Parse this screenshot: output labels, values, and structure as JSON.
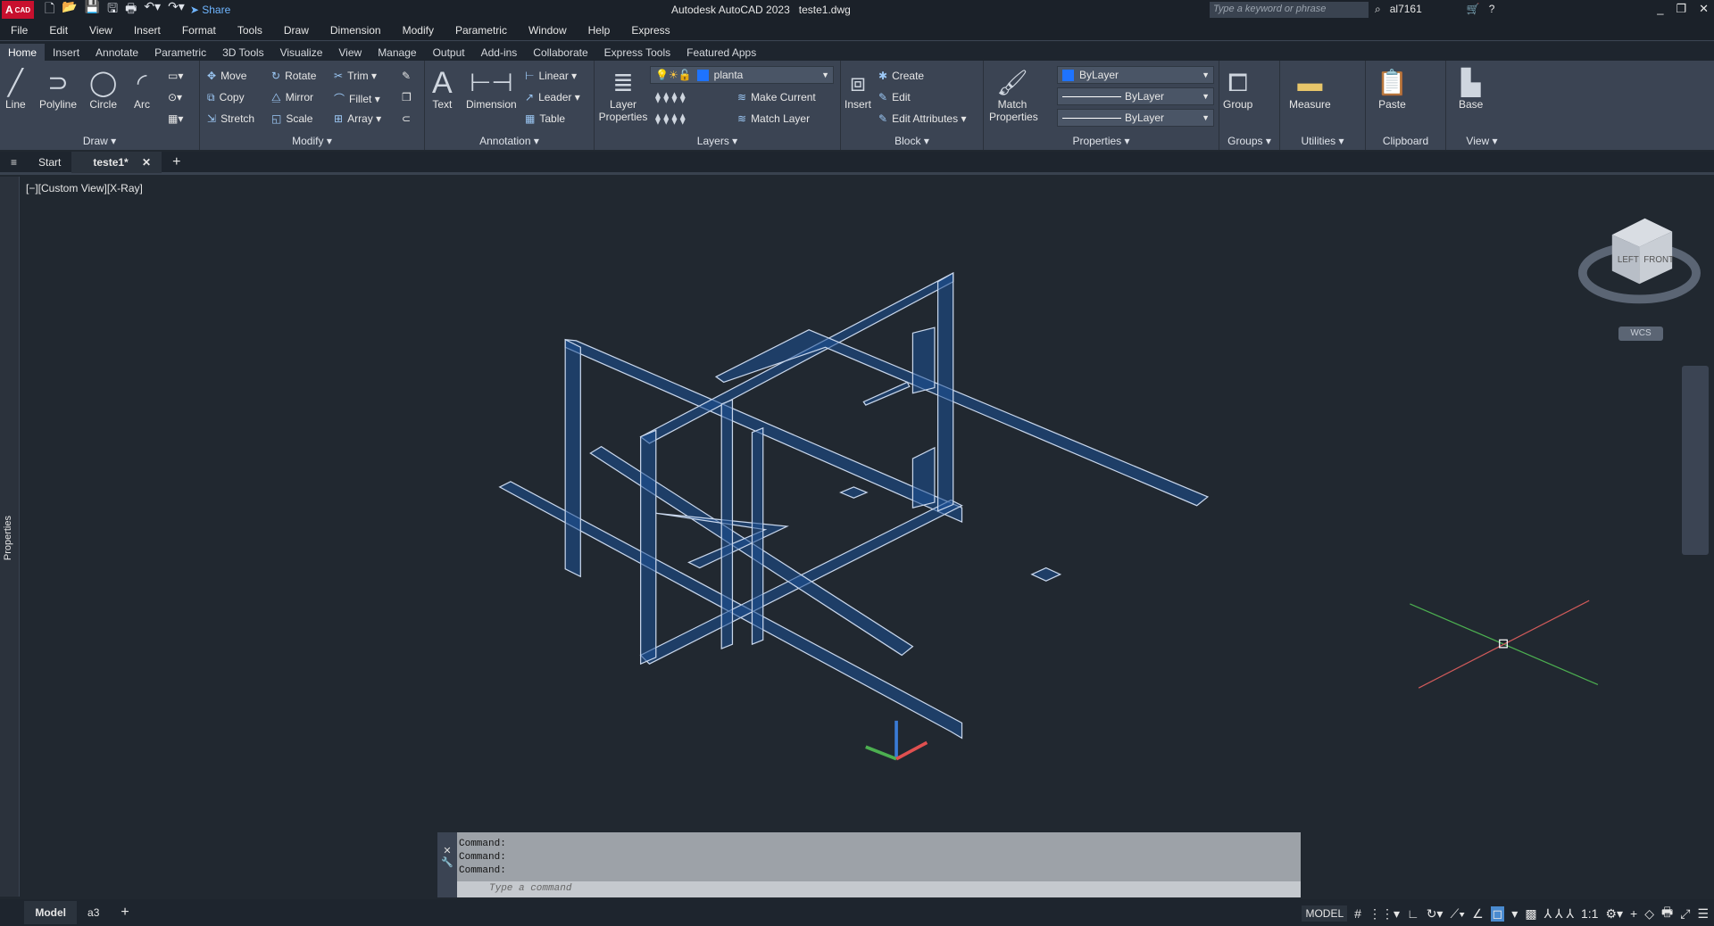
{
  "app": {
    "logo": "A",
    "logo_sub": "CAD",
    "title": "Autodesk AutoCAD 2023",
    "file": "teste1.dwg",
    "share": "Share",
    "search_placeholder": "Type a keyword or phrase",
    "user": "al7161"
  },
  "menu": [
    "File",
    "Edit",
    "View",
    "Insert",
    "Format",
    "Tools",
    "Draw",
    "Dimension",
    "Modify",
    "Parametric",
    "Window",
    "Help",
    "Express"
  ],
  "ribbon_tabs": [
    "Home",
    "Insert",
    "Annotate",
    "Parametric",
    "3D Tools",
    "Visualize",
    "View",
    "Manage",
    "Output",
    "Add-ins",
    "Collaborate",
    "Express Tools",
    "Featured Apps"
  ],
  "draw": {
    "title": "Draw",
    "line": "Line",
    "polyline": "Polyline",
    "circle": "Circle",
    "arc": "Arc"
  },
  "modify": {
    "title": "Modify",
    "move": "Move",
    "rotate": "Rotate",
    "trim": "Trim",
    "copy": "Copy",
    "mirror": "Mirror",
    "fillet": "Fillet",
    "stretch": "Stretch",
    "scale": "Scale",
    "array": "Array"
  },
  "annotation": {
    "title": "Annotation",
    "text": "Text",
    "dimension": "Dimension",
    "linear": "Linear",
    "leader": "Leader",
    "table": "Table"
  },
  "layers": {
    "title": "Layers",
    "layer_properties": "Layer Properties",
    "current_layer": "planta",
    "make_current": "Make Current",
    "match_layer": "Match Layer"
  },
  "block": {
    "title": "Block",
    "insert": "Insert",
    "create": "Create",
    "edit": "Edit",
    "edit_attributes": "Edit Attributes"
  },
  "properties": {
    "title": "Properties",
    "match": "Match Properties",
    "color": "ByLayer",
    "linetype": "ByLayer",
    "lineweight": "ByLayer"
  },
  "groups": {
    "title": "Groups",
    "group": "Group"
  },
  "utilities": {
    "title": "Utilities",
    "measure": "Measure"
  },
  "clipboard": {
    "title": "Clipboard",
    "paste": "Paste"
  },
  "view": {
    "title": "View",
    "base": "Base"
  },
  "file_tabs": {
    "start": "Start",
    "current": "teste1*"
  },
  "viewport": {
    "label": "[−][Custom View][X-Ray]",
    "palette": "Properties",
    "wcs": "WCS",
    "cube_left": "LEFT",
    "cube_front": "FRONT"
  },
  "command": {
    "history": [
      "Command:",
      "Command:",
      "Command:"
    ],
    "placeholder": "Type a command"
  },
  "status": {
    "model_tab": "Model",
    "layout_tab": "a3",
    "model": "MODEL",
    "scale": "1:1"
  },
  "colors": {
    "accent": "#1e73ff",
    "bg": "#212830",
    "ribbon": "#3b4453",
    "logo": "#c8102e"
  }
}
